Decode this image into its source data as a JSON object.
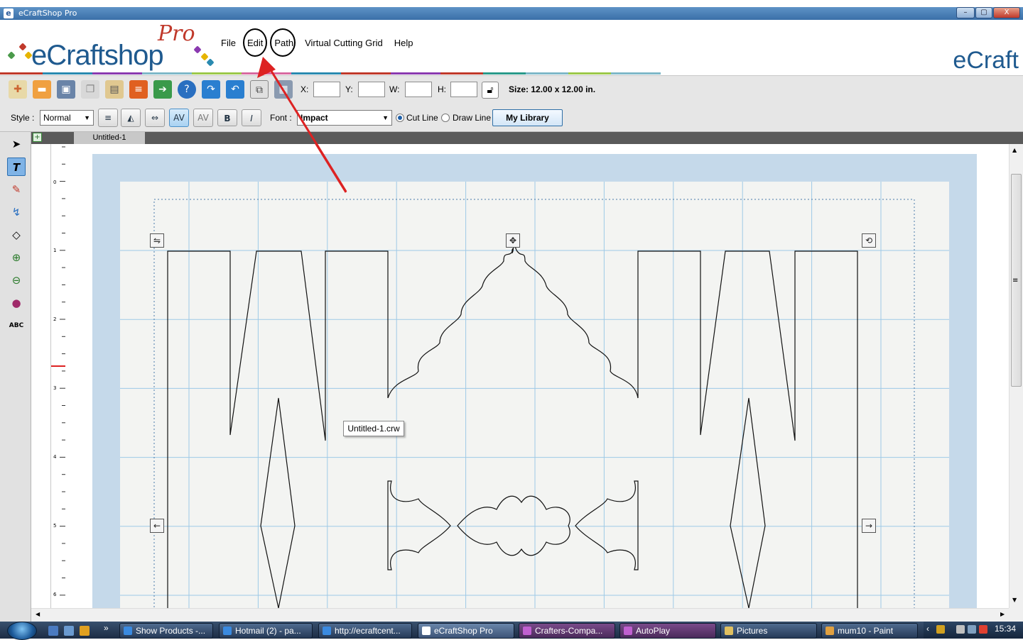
{
  "window": {
    "title": "eCraftShop Pro",
    "controls": {
      "minimize": "–",
      "maximize": "▢",
      "close": "X"
    }
  },
  "logo": {
    "name": "eCraftshop",
    "pro": "Pro",
    "right_name": "eCraft"
  },
  "menu": {
    "items": [
      {
        "label": "File"
      },
      {
        "label": "Edit",
        "circled": true
      },
      {
        "label": "Path",
        "circled": true
      },
      {
        "label": "Virtual Cutting Grid"
      },
      {
        "label": "Help"
      }
    ]
  },
  "annotation": {
    "arrow_color": "#dd2222",
    "ring_color": "#000000"
  },
  "toolbar": {
    "icons": [
      "new-icon",
      "open-icon",
      "save-icon",
      "copy-icon",
      "paste-icon",
      "layers-icon",
      "export-icon",
      "help-icon",
      "redo-icon",
      "undo-icon",
      "group-icon",
      "grid-icon"
    ],
    "x_label": "X:",
    "y_label": "Y:",
    "w_label": "W:",
    "h_label": "H:",
    "x_value": "",
    "y_value": "",
    "w_value": "",
    "h_value": "",
    "size": "Size: 12.00 x 12.00 in."
  },
  "text_toolbar": {
    "style_label": "Style :",
    "style_value": "Normal",
    "bold": "B",
    "italic": "I",
    "font_label": "Font :",
    "font_value": "Impact",
    "cut_line": "Cut Line",
    "draw_line": "Draw Line",
    "cut_line_selected": true,
    "my_library": "My Library"
  },
  "tools": [
    "pointer-tool",
    "text-tool",
    "pencil-tool",
    "bezier-tool",
    "eraser-tool",
    "zoom-in-tool",
    "zoom-out-tool",
    "color-tool",
    "spell-tool"
  ],
  "tabs": [
    {
      "label": "Untitled-1"
    }
  ],
  "ruler": {
    "marks": [
      "0",
      "1",
      "2",
      "3",
      "4",
      "5",
      "6"
    ]
  },
  "canvas": {
    "mat_color": "#c5d9ea",
    "page_color": "#f3f4f2",
    "grid_color": "#9ec9e6",
    "tooltip": "Untitled-1.crw"
  },
  "taskbar": {
    "items": [
      {
        "label": "Show Products -...",
        "icon": "ie-icon"
      },
      {
        "label": "Hotmail (2) - pa...",
        "icon": "ie-icon"
      },
      {
        "label": "http://ecraftcent...",
        "icon": "ie-icon"
      },
      {
        "label": "eCraftShop Pro",
        "icon": "ecraft-icon",
        "active": true
      },
      {
        "label": "Crafters-Compa...",
        "icon": "craft-icon"
      },
      {
        "label": "AutoPlay",
        "icon": "craft-icon"
      },
      {
        "label": "Pictures",
        "icon": "folder-icon"
      },
      {
        "label": "mum10 - Paint",
        "icon": "paint-icon"
      }
    ],
    "chevrons": "»",
    "clock": "15:34"
  }
}
